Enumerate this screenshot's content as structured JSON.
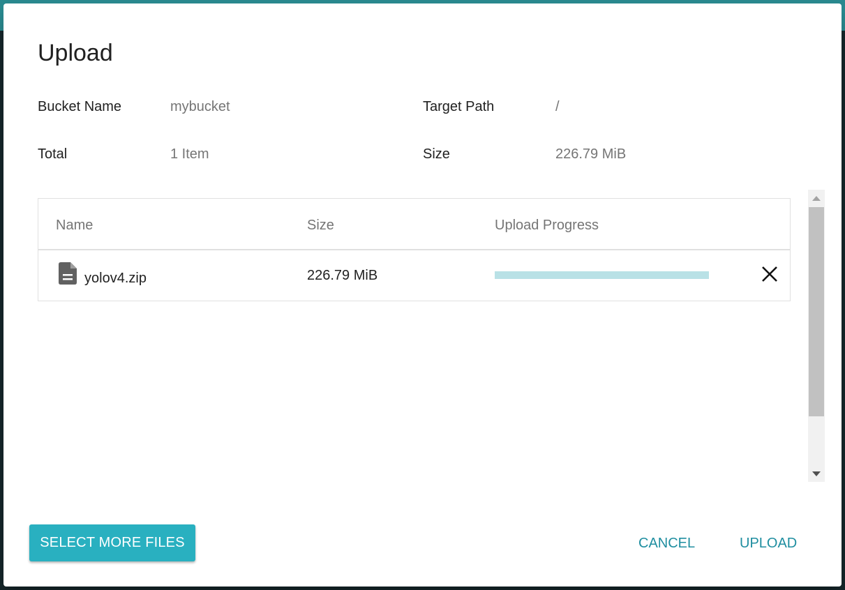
{
  "dialog": {
    "title": "Upload",
    "bucket_name_label": "Bucket Name",
    "bucket_name_value": "mybucket",
    "target_path_label": "Target Path",
    "target_path_value": "/",
    "total_label": "Total",
    "total_value": "1 Item",
    "size_label": "Size",
    "size_value": "226.79 MiB"
  },
  "table": {
    "columns": [
      "Name",
      "Size",
      "Upload Progress"
    ],
    "rows": [
      {
        "name": "yolov4.zip",
        "size": "226.79 MiB",
        "progress": 0,
        "icon": "file-document-icon"
      }
    ]
  },
  "actions": {
    "select_more": "SELECT MORE FILES",
    "cancel": "CANCEL",
    "upload": "UPLOAD"
  },
  "colors": {
    "accent": "#29b0c0",
    "accent_text": "#1f8ea0",
    "progress_track": "#b9e1e6"
  }
}
